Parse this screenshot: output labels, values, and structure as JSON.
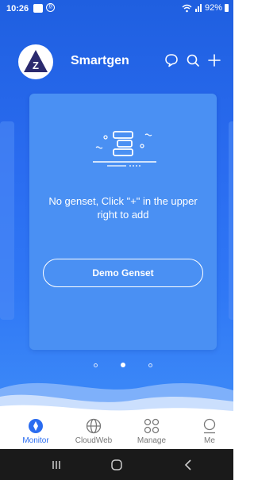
{
  "status_bar": {
    "time": "10:26",
    "notification_badge": "Ⓑ",
    "battery_text": "92%"
  },
  "header": {
    "app_title": "Smartgen",
    "logo_letter": "Z",
    "icons": [
      "chat-icon",
      "search-icon",
      "add-icon"
    ]
  },
  "card": {
    "empty_message": "No genset, Click \"+\" in the upper right to add",
    "demo_button_label": "Demo Genset"
  },
  "pager": {
    "count": 3,
    "active_index": 1
  },
  "bottom_nav": {
    "items": [
      {
        "label": "Monitor",
        "icon": "monitor-icon",
        "active": true
      },
      {
        "label": "CloudWeb",
        "icon": "globe-icon",
        "active": false
      },
      {
        "label": "Manage",
        "icon": "grid-icon",
        "active": false
      },
      {
        "label": "Me",
        "icon": "user-icon",
        "active": false
      }
    ]
  },
  "system_nav": {
    "buttons": [
      "recents-button",
      "home-button",
      "back-button"
    ]
  },
  "colors": {
    "primary": "#2a6cf0",
    "card": "#4a90f3",
    "nav_active": "#2a6cf0",
    "nav_inactive": "#777777"
  }
}
